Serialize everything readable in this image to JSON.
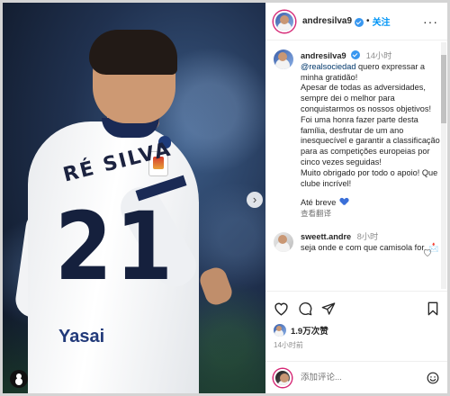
{
  "post": {
    "username": "andresilva9",
    "separator": "•",
    "follow_label": "关注",
    "more_label": "···"
  },
  "photo": {
    "shirt_name": "RÉ SILVA",
    "shirt_number": "21",
    "sponsor_text": "Yasai",
    "next_label": "›"
  },
  "caption": {
    "username": "andresilva9",
    "time": "14小时",
    "mention": "@realsociedad",
    "line1_rest": " quero expressar a minha gratidão!",
    "line2": "Apesar de todas as adversidades, sempre dei o melhor para conquistarmos os nossos objetivos!",
    "line3": "Foi uma honra fazer parte desta família, desfrutar de um ano inesquecível e garantir a classificação para as competições europeias por cinco vezes seguidas!",
    "line4": "Muito obrigado por todo o apoio! Que clube incrível!",
    "line5": "Até breve",
    "translate_label": "查看翻译"
  },
  "reply": {
    "username": "sweett.andre",
    "time": "8小时",
    "text": "seja onde e com que camisola for. 📩"
  },
  "actions": {
    "likes_text": "1.9万次赞",
    "post_time": "14小时前"
  },
  "comment_box": {
    "placeholder": "添加评论..."
  }
}
